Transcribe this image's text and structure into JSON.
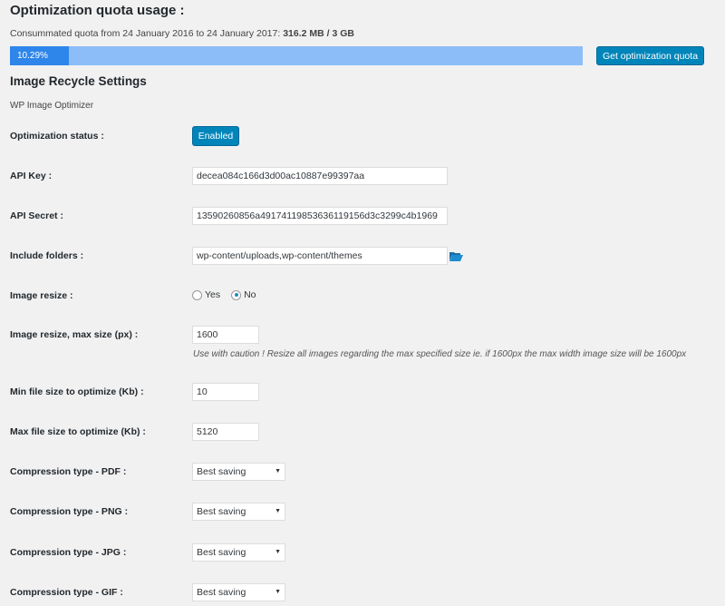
{
  "quota": {
    "title": "Optimization quota usage :",
    "text_prefix": "Consummated quota from 24 January 2016 to 24 January 2017: ",
    "text_bold": "316.2 MB / 3 GB",
    "percent_label": "10.29%",
    "percent": 10.29,
    "button": "Get optimization quota"
  },
  "settings": {
    "title": "Image Recycle Settings",
    "subtitle": "WP Image Optimizer",
    "status_label": "Optimization status :",
    "status_button": "Enabled",
    "api_key_label": "API Key :",
    "api_key": "decea084c166d3d00ac10887e99397aa",
    "api_secret_label": "API Secret :",
    "api_secret": "13590260856a4917411985363611915 6d3c3299c4b1969",
    "folders_label": "Include folders :",
    "folders": "wp-content/uploads,wp-content/themes",
    "resize_label": "Image resize :",
    "resize_yes": "Yes",
    "resize_no": "No",
    "max_size_label": "Image resize, max size (px) :",
    "max_size": "1600",
    "max_size_help": "Use with caution ! Resize all images regarding the max specified size ie. if 1600px the max width image size will be 1600px",
    "min_file_label": "Min file size to optimize (Kb) :",
    "min_file": "10",
    "max_file_label": "Max file size to optimize (Kb) :",
    "max_file": "5120",
    "pdf_label": "Compression type - PDF :",
    "pdf": "Best saving",
    "png_label": "Compression type - PNG :",
    "png": "Best saving",
    "jpg_label": "Compression type - JPG :",
    "jpg": "Best saving",
    "gif_label": "Compression type - GIF :",
    "gif": "Best saving"
  }
}
